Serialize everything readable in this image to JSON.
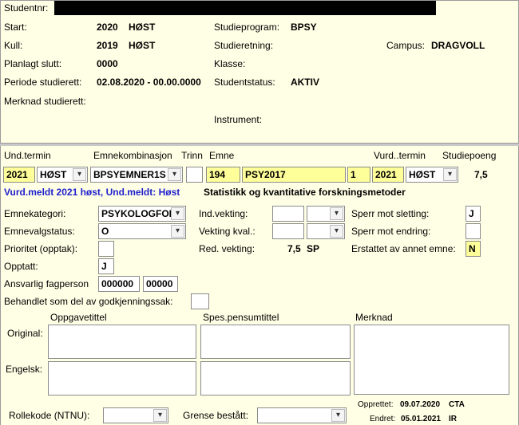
{
  "header": {
    "studentnr_label": "Studentnr:",
    "start_label": "Start:",
    "start_year": "2020",
    "start_term": "HØST",
    "kull_label": "Kull:",
    "kull_year": "2019",
    "kull_term": "HØST",
    "planlagt_label": "Planlagt slutt:",
    "planlagt_value": "0000",
    "periode_label": "Periode studierett:",
    "periode_value": "02.08.2020 - 00.00.0000",
    "merknad_label": "Merknad studierett:",
    "studieprogram_label": "Studieprogram:",
    "studieprogram_value": "BPSY",
    "studieretning_label": "Studieretning:",
    "klasse_label": "Klasse:",
    "studentstatus_label": "Studentstatus:",
    "studentstatus_value": "AKTIV",
    "instrument_label": "Instrument:",
    "campus_label": "Campus:",
    "campus_value": "DRAGVOLL"
  },
  "columns": {
    "und_termin": "Und.termin",
    "emnekombinasjon": "Emnekombinasjon",
    "trinn": "Trinn",
    "emne": "Emne",
    "vurd_termin": "Vurd..termin",
    "studiepoeng": "Studiepoeng"
  },
  "row": {
    "year": "2021",
    "term": "HØST",
    "emnekombinasjon": "BPSYEMNER1S",
    "trinn": "",
    "emne_code": "194",
    "emne_name": "PSY2017",
    "versjon": "1",
    "vurd_year": "2021",
    "vurd_term": "HØST",
    "studiepoeng": "7,5"
  },
  "status_line": "Vurd.meldt 2021 høst, Und.meldt: Høst",
  "course_title": "Statistikk og kvantitative forskningsmetoder",
  "details": {
    "emnekategori_label": "Emnekategori:",
    "emnekategori_value": "PSYKOLOGFOR",
    "emnevalgstatus_label": "Emnevalgstatus:",
    "emnevalgstatus_value": "O",
    "prioritet_label": "Prioritet (opptak):",
    "opptatt_label": "Opptatt:",
    "opptatt_value": "J",
    "ansvarlig_label": "Ansvarlig fagperson",
    "ansvarlig_value1": "000000",
    "ansvarlig_value2": "00000",
    "behandlet_label": "Behandlet som del av godkjenningssak:",
    "indvekting_label": "Ind.vekting:",
    "vekting_kval_label": "Vekting kval.:",
    "red_vekting_label": "Red. vekting:",
    "red_vekting_value": "7,5",
    "red_vekting_unit": "SP",
    "sperr_sletting_label": "Sperr mot sletting:",
    "sperr_sletting_value": "J",
    "sperr_endring_label": "Sperr mot endring:",
    "erstattet_label": "Erstattet av annet emne:",
    "erstattet_value": "N"
  },
  "text_areas": {
    "oppgavetittel_label": "Oppgavetittel",
    "spes_label": "Spes.pensumtittel",
    "merknad_label": "Merknad",
    "original_label": "Original:",
    "engelsk_label": "Engelsk:"
  },
  "footer": {
    "rollekode_label": "Rollekode (NTNU):",
    "grense_label": "Grense bestått:",
    "opprettet_label": "Opprettet:",
    "opprettet_date": "09.07.2020",
    "opprettet_user": "CTA",
    "endret_label": "Endret:",
    "endret_date": "05.01.2021",
    "endret_user": "IR"
  }
}
